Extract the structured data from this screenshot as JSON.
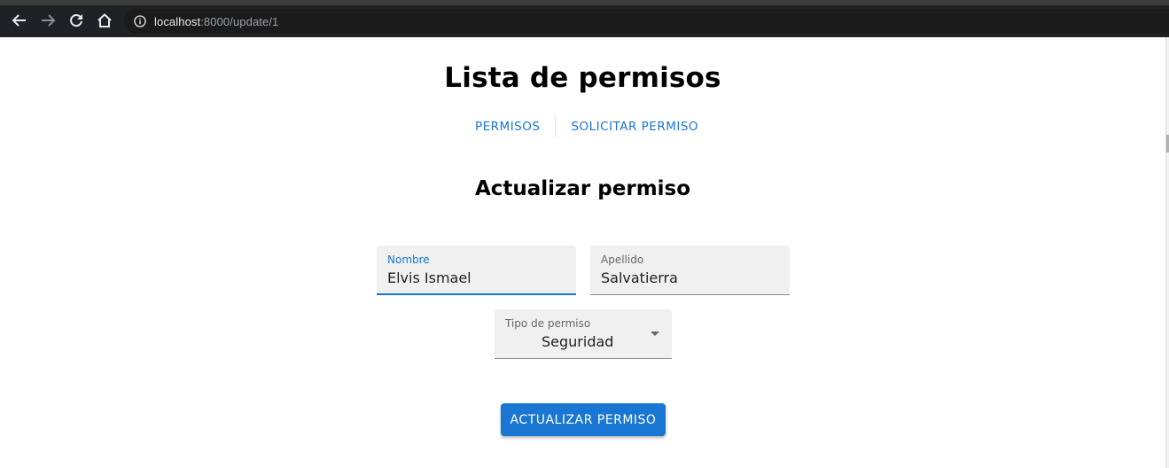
{
  "browser": {
    "url_host": "localhost",
    "url_rest": ":8000/update/1",
    "icons": [
      "back-arrow-icon",
      "forward-arrow-icon",
      "reload-icon",
      "home-icon",
      "info-icon"
    ]
  },
  "header": {
    "title": "Lista de permisos",
    "nav": [
      {
        "label": "PERMISOS"
      },
      {
        "label": "SOLICITAR PERMISO"
      }
    ]
  },
  "form": {
    "title": "Actualizar permiso",
    "fields": {
      "nombre": {
        "label": "Nombre",
        "value": "Elvis Ismael"
      },
      "apellido": {
        "label": "Apellido",
        "value": "Salvatierra"
      },
      "tipo": {
        "label": "Tipo de permiso",
        "value": "Seguridad"
      }
    },
    "submit_label": "ACTUALIZAR PERMISO"
  },
  "colors": {
    "primary": "#1976d2",
    "chrome_bg": "#202124",
    "field_bg": "#f0f0f0"
  }
}
